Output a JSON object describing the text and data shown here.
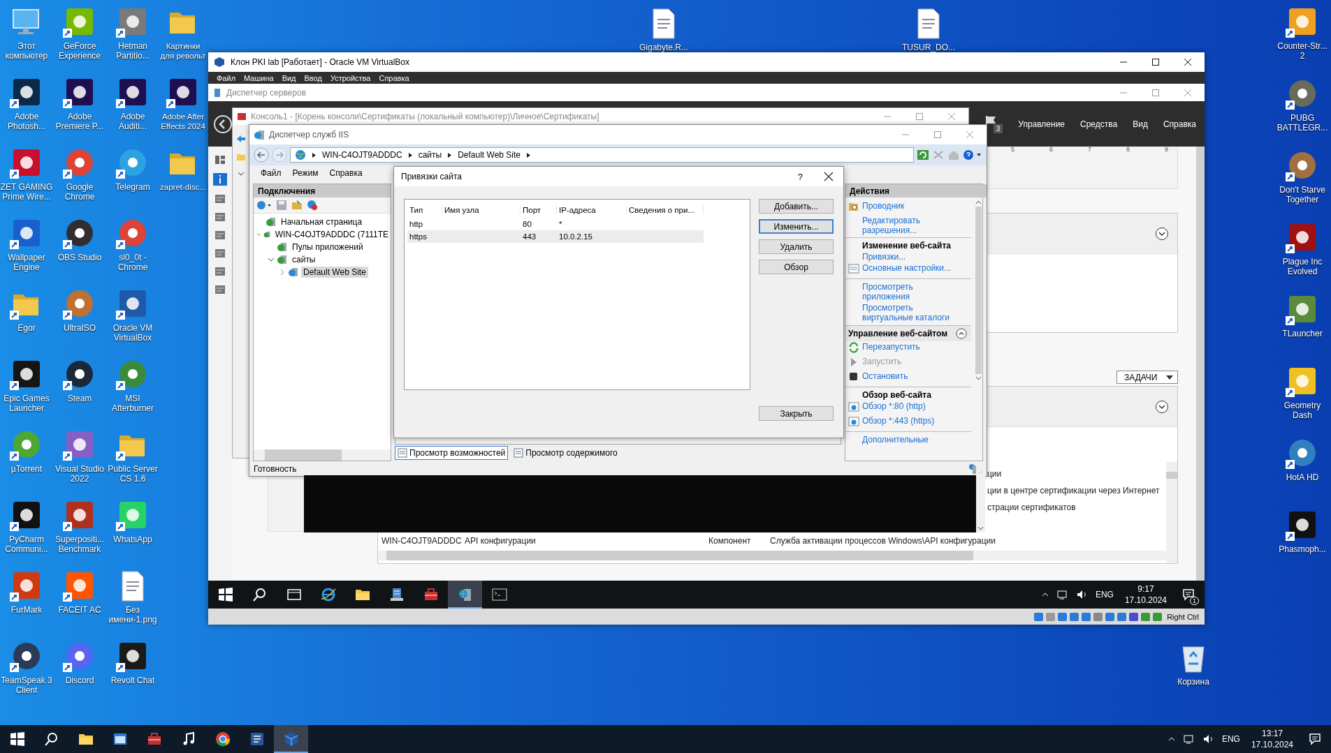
{
  "desktop": {
    "icons_left": [
      {
        "label": "Этот компьютер",
        "kind": "computer",
        "color": "#5ab4f0",
        "shortcut": false
      },
      {
        "label": "Adobe Photosh...",
        "kind": "tile",
        "color": "#0b2a4a",
        "shortcut": true
      },
      {
        "label": "ZET GAMING Prime Wire...",
        "kind": "tile",
        "color": "#c8102e",
        "shortcut": true
      },
      {
        "label": "Wallpaper Engine",
        "kind": "tile",
        "color": "#1a5fd0",
        "shortcut": true
      },
      {
        "label": "Egor",
        "kind": "folder",
        "color": "#f2c94c",
        "shortcut": true
      },
      {
        "label": "Epic Games Launcher",
        "kind": "tile",
        "color": "#151515",
        "shortcut": true
      },
      {
        "label": "µTorrent",
        "kind": "round",
        "color": "#4ca832",
        "shortcut": true
      },
      {
        "label": "PyCharm Communi...",
        "kind": "tile",
        "color": "#111111",
        "shortcut": true
      },
      {
        "label": "FurMark",
        "kind": "tile",
        "color": "#d03a10",
        "shortcut": true
      },
      {
        "label": "TeamSpeak 3 Client",
        "kind": "round",
        "color": "#2a3b57",
        "shortcut": true
      },
      {
        "label": "GeForce Experience",
        "kind": "tile",
        "color": "#76b900",
        "shortcut": true
      },
      {
        "label": "Adobe Premiere P...",
        "kind": "tile",
        "color": "#1e1050",
        "shortcut": true
      },
      {
        "label": "Google Chrome",
        "kind": "round",
        "color": "#db4437",
        "shortcut": true
      },
      {
        "label": "OBS Studio",
        "kind": "round",
        "color": "#302e31",
        "shortcut": true
      },
      {
        "label": "UltraISO",
        "kind": "round",
        "color": "#c07030",
        "shortcut": true
      },
      {
        "label": "Steam",
        "kind": "round",
        "color": "#1b2838",
        "shortcut": true
      },
      {
        "label": "Visual Studio 2022",
        "kind": "tile",
        "color": "#865fc5",
        "shortcut": true
      },
      {
        "label": "Superpositi... Benchmark",
        "kind": "tile",
        "color": "#b03020",
        "shortcut": true
      },
      {
        "label": "FACEIT AC",
        "kind": "tile",
        "color": "#ff5500",
        "shortcut": true
      },
      {
        "label": "Discord",
        "kind": "round",
        "color": "#5865f2",
        "shortcut": true
      },
      {
        "label": "Hetman Partitio...",
        "kind": "tile",
        "color": "#7a7a7a",
        "shortcut": true
      },
      {
        "label": "Adobe Auditi...",
        "kind": "tile",
        "color": "#1e1050",
        "shortcut": true
      },
      {
        "label": "Telegram",
        "kind": "round",
        "color": "#2aa3e0",
        "shortcut": true
      },
      {
        "label": "sl0_0t - Chrome",
        "kind": "round",
        "color": "#db4437",
        "shortcut": true
      },
      {
        "label": "Oracle VM VirtualBox",
        "kind": "tile",
        "color": "#1e5aa8",
        "shortcut": true
      },
      {
        "label": "MSI Afterburner",
        "kind": "round",
        "color": "#3a8a3a",
        "shortcut": true
      },
      {
        "label": "Public Server CS 1.6",
        "kind": "folder",
        "color": "#f2c94c",
        "shortcut": true
      },
      {
        "label": "WhatsApp",
        "kind": "tile",
        "color": "#25d366",
        "shortcut": true
      },
      {
        "label": "Без имени-1.png",
        "kind": "file",
        "color": "#ffffff",
        "shortcut": false
      },
      {
        "label": "Revolt Chat",
        "kind": "tile",
        "color": "#1a1a1a",
        "shortcut": true
      },
      {
        "label": "Картинки для револьт",
        "kind": "folder",
        "color": "#f2c94c",
        "shortcut": false
      },
      {
        "label": "Adobe After Effects 2024",
        "kind": "tile",
        "color": "#1e1050",
        "shortcut": true
      },
      {
        "label": "zapret-disc...",
        "kind": "folder",
        "color": "#f2c94c",
        "shortcut": false
      }
    ],
    "icons_top": [
      {
        "label": "Gigabyte.R...",
        "kind": "file",
        "color": "#ffffff",
        "shortcut": false
      },
      {
        "label": "TUSUR_DO...",
        "kind": "file",
        "color": "#ffffff",
        "shortcut": false
      }
    ],
    "icons_right": [
      {
        "label": "Counter-Str... 2",
        "kind": "tile",
        "color": "#f0a020",
        "shortcut": true
      },
      {
        "label": "PUBG BATTLEGR...",
        "kind": "round",
        "color": "#6a6a5a",
        "shortcut": true
      },
      {
        "label": "Don't Starve Together",
        "kind": "round",
        "color": "#a07040",
        "shortcut": true
      },
      {
        "label": "Plague Inc Evolved",
        "kind": "tile",
        "color": "#a01010",
        "shortcut": true
      },
      {
        "label": "TLauncher",
        "kind": "tile",
        "color": "#5a8a3a",
        "shortcut": true
      },
      {
        "label": "Geometry Dash",
        "kind": "tile",
        "color": "#f0c020",
        "shortcut": true
      },
      {
        "label": "HotA HD",
        "kind": "round",
        "color": "#3080c0",
        "shortcut": true
      },
      {
        "label": "Phasmoph...",
        "kind": "tile",
        "color": "#111111",
        "shortcut": true
      }
    ],
    "recycle_bin": {
      "label": "Корзина",
      "kind": "bin",
      "color": "#e0e8f0",
      "shortcut": false
    }
  },
  "vbox": {
    "title": "Клон PKI lab [Работает] - Oracle VM VirtualBox",
    "menu": [
      "Файл",
      "Машина",
      "Вид",
      "Ввод",
      "Устройства",
      "Справка"
    ],
    "host_key": "Right Ctrl"
  },
  "server_manager": {
    "title": "Диспетчер серверов",
    "menu": [
      "Управление",
      "Средства",
      "Вид",
      "Справка"
    ],
    "flag_count": "3",
    "ticks": [
      "5",
      "6",
      "7",
      "8",
      "9"
    ],
    "tasks_button": "ЗАДАЧИ",
    "fragments": [
      "ции",
      "ции в центре сертификации через Интернет",
      "страции сертификатов"
    ],
    "row": [
      "WIN-C4OJT9ADDDC",
      "API конфигурации",
      "Компонент",
      "Служба активации процессов Windows\\API конфигурации"
    ]
  },
  "console": {
    "title": "Консоль1 - [Корень консоли\\Сертификаты (локальный компьютер)\\Личное\\Сертификаты]"
  },
  "iis": {
    "title": "Диспетчер служб IIS",
    "breadcrumb": [
      "WIN-C4OJT9ADDDC",
      "сайты",
      "Default Web Site"
    ],
    "menu": [
      "Файл",
      "Режим",
      "Справка"
    ],
    "connections": {
      "title": "Подключения",
      "tree": [
        {
          "label": "Начальная страница",
          "selected": false
        },
        {
          "label": "WIN-C4OJT9ADDDC (7111TE",
          "selected": false,
          "expanded": true,
          "children": [
            {
              "label": "Пулы приложений",
              "selected": false
            },
            {
              "label": "сайты",
              "selected": false,
              "expanded": true,
              "children": [
                {
                  "label": "Default Web Site",
                  "selected": true,
                  "expanded": false
                }
              ]
            }
          ]
        }
      ]
    },
    "view_tabs": [
      {
        "label": "Просмотр возможностей",
        "selected": true
      },
      {
        "label": "Просмотр содержимого",
        "selected": false
      }
    ],
    "status": "Готовность",
    "actions": {
      "title": "Действия",
      "items": [
        {
          "kind": "link",
          "text": "Проводник"
        },
        {
          "kind": "link",
          "text": "Редактировать разрешения..."
        },
        {
          "kind": "heading",
          "text": "Изменение веб-сайта",
          "divider": true
        },
        {
          "kind": "link",
          "text": "Привязки..."
        },
        {
          "kind": "link",
          "text": "Основные настройки..."
        },
        {
          "kind": "link",
          "text": "Просмотреть приложения",
          "divider": true
        },
        {
          "kind": "link",
          "text": "Просмотреть виртуальные каталоги"
        },
        {
          "kind": "section",
          "text": "Управление веб-сайтом"
        },
        {
          "kind": "link",
          "text": "Перезапустить"
        },
        {
          "kind": "disabled",
          "text": "Запустить"
        },
        {
          "kind": "link",
          "text": "Остановить"
        },
        {
          "kind": "heading",
          "text": "Обзор веб-сайта",
          "divider": true
        },
        {
          "kind": "link",
          "text": "Обзор *:80 (http)"
        },
        {
          "kind": "link",
          "text": "Обзор *:443 (https)"
        },
        {
          "kind": "link",
          "text": "Дополнительные",
          "divider": true
        }
      ]
    }
  },
  "bindings_dialog": {
    "title": "Привязки сайта",
    "help": "?",
    "columns": [
      "Тип",
      "Имя узла",
      "Порт",
      "IP-адреса",
      "Сведения о при..."
    ],
    "rows": [
      {
        "cells": [
          "http",
          "",
          "80",
          "*",
          ""
        ],
        "selected": false
      },
      {
        "cells": [
          "https",
          "",
          "443",
          "10.0.2.15",
          ""
        ],
        "selected": true
      }
    ],
    "buttons": [
      {
        "label": "Добавить...",
        "focused": false
      },
      {
        "label": "Изменить...",
        "focused": true
      },
      {
        "label": "Удалить",
        "focused": false
      },
      {
        "label": "Обзор",
        "focused": false
      }
    ],
    "close_button": "Закрыть"
  },
  "guest_taskbar": {
    "apps": [
      {
        "kind": "taskview",
        "selected": false
      },
      {
        "kind": "ie",
        "selected": false
      },
      {
        "kind": "explorer",
        "selected": false
      },
      {
        "kind": "server",
        "selected": false
      },
      {
        "kind": "toolbox",
        "selected": false
      },
      {
        "kind": "iis",
        "selected": true
      },
      {
        "kind": "cmd",
        "selected": false
      }
    ],
    "lang": "ENG",
    "time": "9:17",
    "date": "17.10.2024",
    "notifications": "1"
  },
  "host_taskbar": {
    "apps": [
      {
        "kind": "explorer",
        "selected": false
      },
      {
        "kind": "store",
        "selected": false
      },
      {
        "kind": "toolbox",
        "selected": false
      },
      {
        "kind": "music",
        "selected": false
      },
      {
        "kind": "chrome",
        "selected": false
      },
      {
        "kind": "word",
        "selected": false
      },
      {
        "kind": "vbox",
        "selected": true
      }
    ],
    "lang": "ENG",
    "time": "13:17",
    "date": "17.10.2024"
  }
}
